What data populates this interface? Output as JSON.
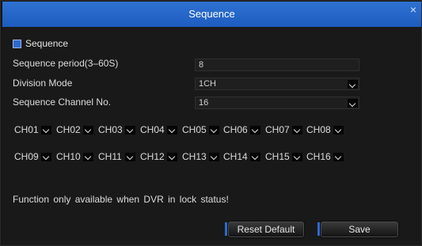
{
  "dialog": {
    "title": "Sequence",
    "close_glyph": "×"
  },
  "sequence_checkbox": {
    "label": "Sequence",
    "checked": true
  },
  "fields": {
    "period_label": "Sequence period(3–60S)",
    "period_value": "8",
    "division_label": "Division Mode",
    "division_value": "1CH",
    "channel_no_label": "Sequence Channel No.",
    "channel_no_value": "16"
  },
  "channels_row1": [
    "CH01",
    "CH02",
    "CH03",
    "CH04",
    "CH05",
    "CH06",
    "CH07",
    "CH08"
  ],
  "channels_row2": [
    "CH09",
    "CH10",
    "CH11",
    "CH12",
    "CH13",
    "CH14",
    "CH15",
    "CH16"
  ],
  "note": "Function only available when DVR in lock status!",
  "buttons": {
    "reset": "Reset Default",
    "save": "Save"
  },
  "colors": {
    "accent": "#2d6ad0",
    "title_bar": "#1d5cbf"
  }
}
